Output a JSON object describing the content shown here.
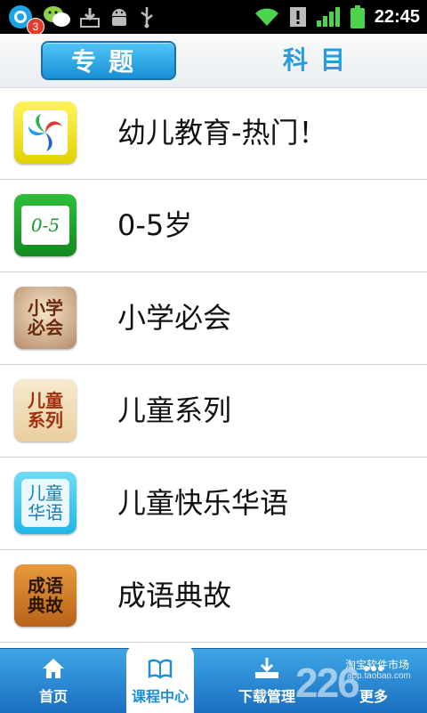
{
  "status_bar": {
    "notification_count": "3",
    "time": "22:45",
    "icons": [
      "qq-app-icon",
      "wechat-icon",
      "download-icon",
      "android-debug-icon",
      "usb-icon",
      "wifi-icon",
      "alert-icon",
      "signal-icon",
      "battery-icon"
    ]
  },
  "header": {
    "tabs": [
      {
        "label": "专题",
        "active": true
      },
      {
        "label": "科目",
        "active": false
      }
    ]
  },
  "list": {
    "items": [
      {
        "label": "幼儿教育-热门！",
        "icon": "logo-swirl-icon"
      },
      {
        "label": "0-5岁",
        "icon": "age-0-5-icon",
        "icon_text": "0-5"
      },
      {
        "label": "小学必会",
        "icon": "primary-school-icon",
        "icon_text": "小学必会"
      },
      {
        "label": "儿童系列",
        "icon": "children-series-icon",
        "icon_text": "儿童系列"
      },
      {
        "label": "儿童快乐华语",
        "icon": "happy-chinese-icon",
        "icon_text": "儿童华语"
      },
      {
        "label": "成语典故",
        "icon": "idiom-story-icon",
        "icon_text": "成语典故"
      }
    ]
  },
  "tabbar": {
    "tabs": [
      {
        "label": "首页",
        "icon": "home-icon"
      },
      {
        "label": "课程中心",
        "icon": "book-icon",
        "active": true
      },
      {
        "label": "下载管理",
        "icon": "download-icon"
      },
      {
        "label": "更多",
        "icon": "more-icon"
      }
    ]
  },
  "watermark": {
    "brand": "226",
    "text": "淘宝软件市场",
    "url": "app.taobao.com"
  },
  "colors": {
    "accent": "#1a8fd7",
    "tabbar": "#2a86d2",
    "status_bar": "#000000"
  }
}
